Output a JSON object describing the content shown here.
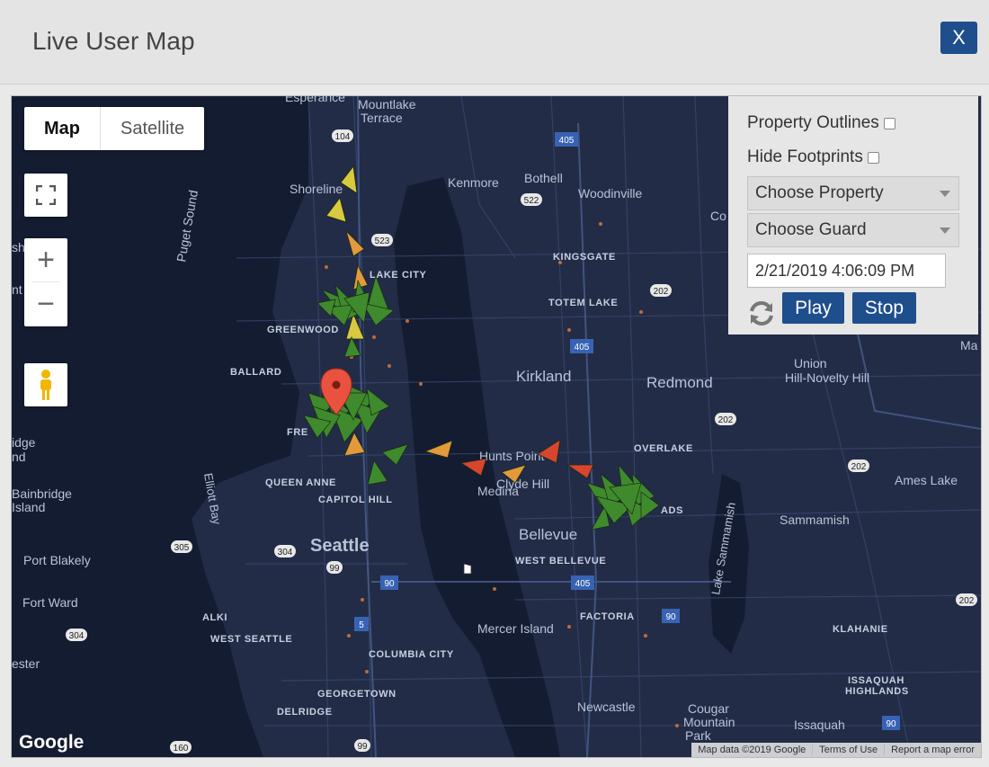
{
  "modal": {
    "title": "Live User Map",
    "close_label": "X"
  },
  "map_controls": {
    "map_type": {
      "active": "Map",
      "options": [
        "Map",
        "Satellite"
      ]
    },
    "zoom_in": "+",
    "zoom_out": "−"
  },
  "panel": {
    "property_outlines_label": "Property Outlines",
    "hide_footprints_label": "Hide Footprints",
    "property_select": "Choose Property",
    "guard_select": "Choose Guard",
    "datetime_value": "2/21/2019 4:06:09 PM",
    "play_label": "Play",
    "stop_label": "Stop"
  },
  "map_labels": {
    "places": [
      "Esperance",
      "Mountlake Terrace",
      "Shoreline",
      "Kenmore",
      "Bothell",
      "Woodinville",
      "Puget Sound",
      "Lake City",
      "Kingsgate",
      "Totem Lake",
      "Greenwood",
      "Ballard",
      "Kirkland",
      "Redmond",
      "Union Hill-Novelty Hill",
      "Overlake",
      "Hunts Point",
      "Clyde Hill",
      "Medina",
      "Queen Anne",
      "Capitol Hill",
      "Seattle",
      "Bellevue",
      "West Bellevue",
      "Ames Lake",
      "Sammamish",
      "Lake Sammamish",
      "Bainbridge Island",
      "Port Blakely",
      "Fort Ward",
      "Elliott Bay",
      "Alki",
      "West Seattle",
      "Columbia City",
      "Mercer Island",
      "Factoria",
      "Klahanie",
      "Issaquah Highlands",
      "Georgetown",
      "Delridge",
      "Newcastle",
      "Cougar Mountain",
      "Issaquah"
    ],
    "fragments": [
      "Co",
      "Ma",
      "sh",
      "nt",
      "idge",
      "nd",
      "ester",
      "ADS",
      "FRE"
    ],
    "shields": [
      "104",
      "405",
      "522",
      "523",
      "202",
      "405",
      "202",
      "202",
      "305",
      "304",
      "99",
      "90",
      "405",
      "90",
      "5",
      "304",
      "202",
      "90",
      "160",
      "99"
    ]
  },
  "colors": {
    "accent": "#1f4e8c",
    "map_bg": "#1f2942",
    "water": "#121a2e",
    "road": "#3a4a72",
    "pin": "#e8523f",
    "arrow_green": "#3f8a2c",
    "arrow_yellow": "#d9c93e",
    "arrow_orange": "#e39a3b",
    "arrow_red": "#d7452e"
  },
  "attribution": {
    "logo": "Google",
    "map_data": "Map data ©2019 Google",
    "terms": "Terms of Use",
    "report": "Report a map error"
  }
}
